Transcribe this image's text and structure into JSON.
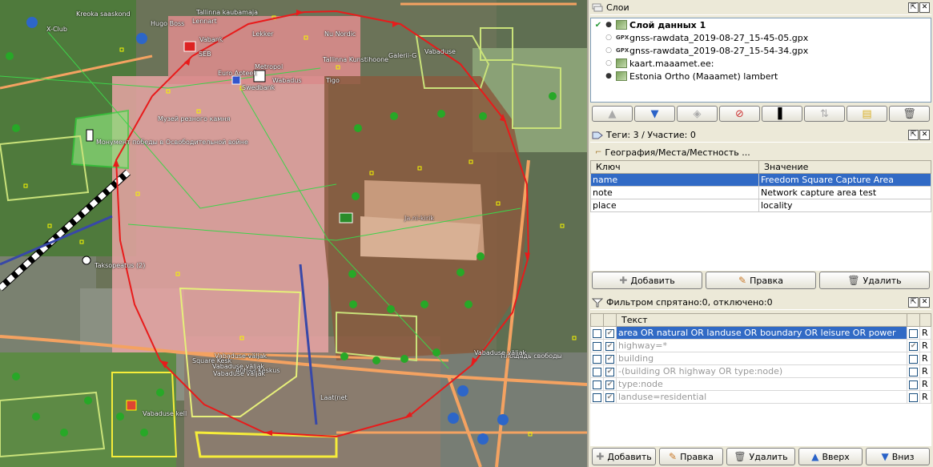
{
  "map": {
    "labels": [
      {
        "text": "X-Club"
      },
      {
        "text": "Kreoka saaskond"
      },
      {
        "text": "Hugo Boss"
      },
      {
        "text": "Tallinna kaubamaja"
      },
      {
        "text": "Lennart"
      },
      {
        "text": "Vabank"
      },
      {
        "text": "SEB"
      },
      {
        "text": "Lekker"
      },
      {
        "text": "Nu Nordic"
      },
      {
        "text": "Tallinna Kunstihoone"
      },
      {
        "text": "Galerii-G"
      },
      {
        "text": "Vabaduse"
      },
      {
        "text": "Euro Apteek"
      },
      {
        "text": "Metropol"
      },
      {
        "text": "Swedbank"
      },
      {
        "text": "Wabadus"
      },
      {
        "text": "Tigo"
      },
      {
        "text": "Музей резного камня"
      },
      {
        "text": "Монумент победы в Освободительной войне"
      },
      {
        "text": "Ja.ni-kirik"
      },
      {
        "text": "Vabaduse väljak"
      },
      {
        "text": "Square Kesk"
      },
      {
        "text": "Anhaa Keskus"
      },
      {
        "text": "Vabaduse väljak"
      },
      {
        "text": "Vabaduse väljak"
      },
      {
        "text": "Vabaduse kell"
      },
      {
        "text": "Taksopeatus (2)"
      },
      {
        "text": "Площадь свободы"
      },
      {
        "text": "Vabaduse väljak"
      },
      {
        "text": "Laat(net"
      }
    ]
  },
  "layers_panel": {
    "title": "Слои",
    "items": [
      {
        "name": "Слой данных 1",
        "type": "data",
        "active": true,
        "visible": true
      },
      {
        "name": "gnss-rawdata_2019-08-27_15-45-05.gpx",
        "type": "gpx",
        "active": false,
        "visible": false
      },
      {
        "name": "gnss-rawdata_2019-08-27_15-54-34.gpx",
        "type": "gpx",
        "active": false,
        "visible": false
      },
      {
        "name": "kaart.maaamet.ee:",
        "type": "imagery",
        "active": false,
        "visible": false
      },
      {
        "name": "Estonia Ortho (Maaamet) lambert",
        "type": "imagery",
        "active": false,
        "visible": true
      }
    ],
    "gpx_badge": "GPX"
  },
  "tags_panel": {
    "title": "Теги: 3 / Участие: 0",
    "preset": "География/Места/Местность ...",
    "col_key": "Ключ",
    "col_value": "Значение",
    "rows": [
      {
        "key": "name",
        "value": "Freedom Square Capture Area"
      },
      {
        "key": "note",
        "value": "Network capture area test"
      },
      {
        "key": "place",
        "value": "locality"
      }
    ],
    "add": "Добавить",
    "edit": "Правка",
    "delete": "Удалить"
  },
  "filter_panel": {
    "title": "Фильтром спрятано:0, отключено:0",
    "col_text": "Текст",
    "rows": [
      {
        "text": "area OR natural OR landuse OR boundary OR leisure OR power",
        "flag": "R"
      },
      {
        "text": "highway=*",
        "flag": "R"
      },
      {
        "text": "building",
        "flag": "R"
      },
      {
        "text": "-(building OR highway OR type:node)",
        "flag": "R"
      },
      {
        "text": "type:node",
        "flag": "R"
      },
      {
        "text": "landuse=residential",
        "flag": "R"
      }
    ],
    "add": "Добавить",
    "edit": "Правка",
    "delete": "Удалить",
    "up": "Вверх",
    "down": "Вниз"
  },
  "colors": {
    "selection": "#316ac5",
    "capture_area": "#e81b1b"
  }
}
